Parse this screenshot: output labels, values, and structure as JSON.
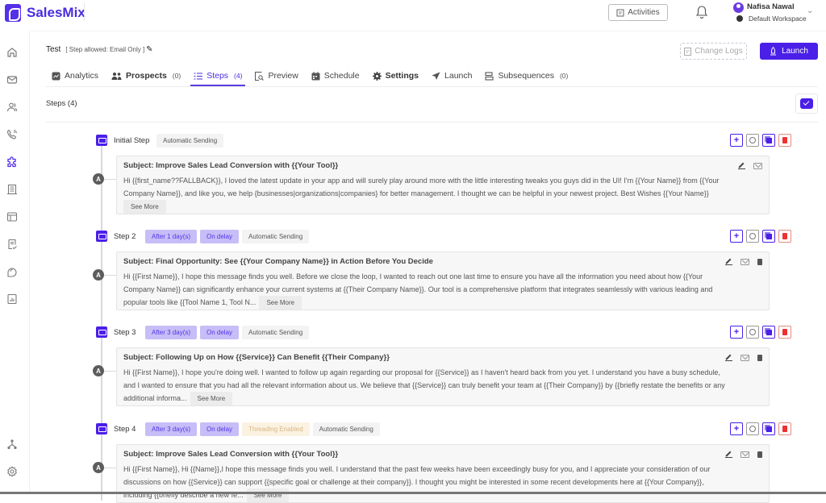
{
  "app": {
    "brand": "SalesMix",
    "brand_color": "#4a2be0",
    "accent_color": "#4a1fe8"
  },
  "header": {
    "activities_label": "Activities",
    "user_name": "Nafisa Nawal",
    "workspace": "Default Workspace"
  },
  "sidebar": {
    "items": [
      {
        "icon": "home-icon",
        "active": false
      },
      {
        "icon": "mail-icon",
        "active": false
      },
      {
        "icon": "users-icon",
        "active": false
      },
      {
        "icon": "phone-icon",
        "active": false
      },
      {
        "icon": "puzzle-icon",
        "active": true
      },
      {
        "icon": "building-icon",
        "active": false
      },
      {
        "icon": "table-icon",
        "active": false
      },
      {
        "icon": "document-check-icon",
        "active": false
      },
      {
        "icon": "chat-icon",
        "active": false
      },
      {
        "icon": "report-icon",
        "active": false
      }
    ],
    "bottom_items": [
      {
        "icon": "hierarchy-icon"
      },
      {
        "icon": "settings-icon"
      }
    ]
  },
  "campaign": {
    "title": "Test",
    "allowed": "[ Step allowed: Email Only ]",
    "change_logs_label": "Change Logs",
    "launch_label": "Launch"
  },
  "tabs": [
    {
      "label": "Analytics",
      "count": "",
      "icon": "analytics-icon",
      "active": false,
      "bold": false
    },
    {
      "label": "Prospects",
      "count": "(0)",
      "icon": "prospects-icon",
      "active": false,
      "bold": true
    },
    {
      "label": "Steps",
      "count": "(4)",
      "icon": "steps-icon",
      "active": true,
      "bold": false
    },
    {
      "label": "Preview",
      "count": "",
      "icon": "preview-icon",
      "active": false,
      "bold": false
    },
    {
      "label": "Schedule",
      "count": "",
      "icon": "schedule-icon",
      "active": false,
      "bold": false
    },
    {
      "label": "Settings",
      "count": "",
      "icon": "settings-icon",
      "active": false,
      "bold": true
    },
    {
      "label": "Launch",
      "count": "",
      "icon": "launch-icon",
      "active": false,
      "bold": false
    },
    {
      "label": "Subsequences",
      "count": "(0)",
      "icon": "subsequences-icon",
      "active": false,
      "bold": false
    }
  ],
  "steps_header": "Steps (4)",
  "see_more_label": "See More",
  "node_label": "A",
  "steps": [
    {
      "name": "Initial Step",
      "badges": [
        {
          "text": "Automatic Sending",
          "type": "auto"
        }
      ],
      "subject": "Subject: Improve Sales Lead Conversion with {{Your Tool}}",
      "body": "Hi {{first_name??FALLBACK}},   I loved the latest update in your app and will surely play around more with the little interesting tweaks you guys did in the UI! I'm {{Your Name}} from {{Your Company Name}}, and like you, we help {businesses|organizations|companies} for better management. I thought we can be helpful in your newest project.   Best Wishes {{Your Name}}",
      "has_trash": false
    },
    {
      "name": "Step 2",
      "badges": [
        {
          "text": "After 1 day(s)",
          "type": "delay"
        },
        {
          "text": "On delay",
          "type": "delay"
        },
        {
          "text": "Automatic Sending",
          "type": "auto"
        }
      ],
      "subject": "Subject: Final Opportunity: See {{Your Company Name}} in Action Before You Decide",
      "body": "Hi {{First Name}}, I hope this message finds you well. Before we close the loop, I wanted to reach out one last time to ensure you have all the information you need about how {{Your Company Name}} can significantly enhance your current systems at {{Their Company Name}}. Our tool is a comprehensive platform that integrates seamlessly with various leading and popular tools like {{Tool Name 1, Tool N...",
      "has_trash": true
    },
    {
      "name": "Step 3",
      "badges": [
        {
          "text": "After 3 day(s)",
          "type": "delay"
        },
        {
          "text": "On delay",
          "type": "delay"
        },
        {
          "text": "Automatic Sending",
          "type": "auto"
        }
      ],
      "subject": "Subject: Following Up on How {{Service}} Can Benefit {{Their Company}}",
      "body": "Hi {{First Name}}, I hope you're doing well. I wanted to follow up again regarding our proposal for {{Service}} as I haven't heard back from you yet. I understand you have a busy schedule, and I wanted to ensure that you had all the relevant information about us. We believe that {{Service}} can truly benefit your team at {{Their Company}} by {{briefly restate the benefits or any additional informa...",
      "has_trash": true
    },
    {
      "name": "Step 4",
      "badges": [
        {
          "text": "After 3 day(s)",
          "type": "delay"
        },
        {
          "text": "On delay",
          "type": "delay"
        },
        {
          "text": "Threading Enabled",
          "type": "thread"
        },
        {
          "text": "Automatic Sending",
          "type": "auto"
        }
      ],
      "subject": "Subject: Improve Sales Lead Conversion with {{Your Tool}}",
      "body": "Hi {{First Name}}, Hi {{Name}},I hope this message finds you well. I understand that the past few weeks have been exceedingly busy for you, and I appreciate your consideration of our discussions on how {{Service}} can support {{specific goal or challenge at their company}}. I thought you might be interested in some recent developments here at {{Your Company}}, including {{briefly describe a new fe...",
      "has_trash": true
    }
  ]
}
